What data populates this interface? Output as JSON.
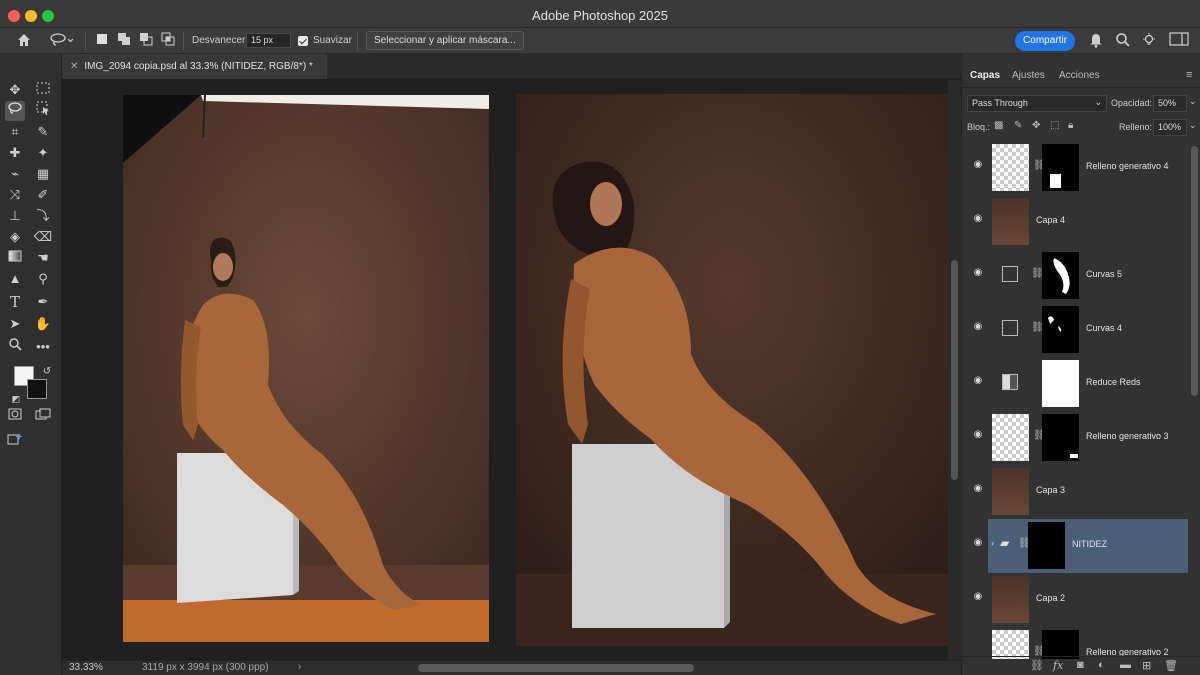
{
  "app": {
    "title": "Adobe Photoshop 2025"
  },
  "options_bar": {
    "feather_label": "Desvanecer:",
    "feather_value": "15 px",
    "antialias_label": "Suavizar",
    "select_mask_button": "Seleccionar y aplicar máscara...",
    "share_button": "Compartir"
  },
  "document": {
    "tab_title": "IMG_2094 copia.psd al 33.3% (NITIDEZ, RGB/8*) *",
    "zoom": "33.33%",
    "dimensions": "3119 px x 3994 px (300 ppp)",
    "status_arrow": "›"
  },
  "layers_panel": {
    "tabs": [
      "Capas",
      "Ajustes",
      "Acciones"
    ],
    "blend_mode": "Pass Through",
    "opacity_label": "Opacidad:",
    "opacity_value": "50%",
    "lock_label": "Bloq.:",
    "fill_label": "Relleno:",
    "fill_value": "100%",
    "layers": [
      {
        "name": "Relleno generativo 4",
        "kind": "generative"
      },
      {
        "name": "Capa 4",
        "kind": "pixel"
      },
      {
        "name": "Curvas 5",
        "kind": "curves"
      },
      {
        "name": "Curvas 4",
        "kind": "curves"
      },
      {
        "name": "Reduce Reds",
        "kind": "adjustment"
      },
      {
        "name": "Relleno generativo 3",
        "kind": "generative"
      },
      {
        "name": "Capa 3",
        "kind": "pixel"
      },
      {
        "name": "NITIDEZ",
        "kind": "group",
        "selected": true
      },
      {
        "name": "Capa 2",
        "kind": "pixel"
      },
      {
        "name": "Relleno generativo 2",
        "kind": "generative"
      }
    ]
  },
  "colors": {
    "accent": "#2275e6",
    "selected_layer": "#4b5e78",
    "backdrop": "#4f3528",
    "dress": "#a8673a"
  }
}
